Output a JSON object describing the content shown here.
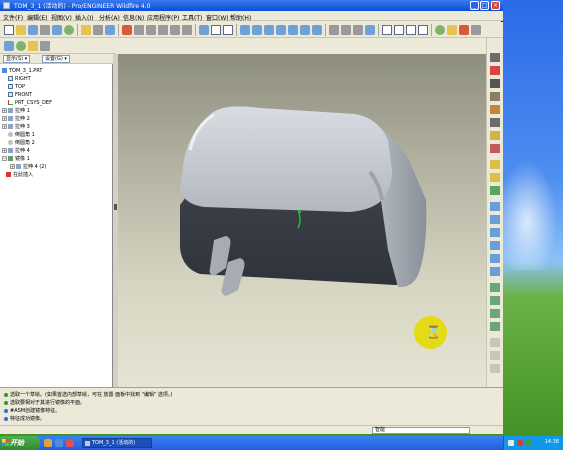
{
  "window": {
    "title": "TOM_3_1 (活动的) - Pro/ENGINEER Wildfire 4.0"
  },
  "menu": [
    "文件(F)",
    "编辑(E)",
    "视图(V)",
    "插入(I)",
    "分析(A)",
    "信息(N)",
    "应用程序(P)",
    "工具(T)",
    "窗口(W)",
    "帮助(H)"
  ],
  "left_panel": {
    "show_button": "显示(S) ▾",
    "settings_button": "设置(G) ▾",
    "tree": [
      {
        "label": "TOM_3_1.PRT",
        "icon": "part-icon",
        "expand": ""
      },
      {
        "label": "RIGHT",
        "icon": "datum-plane-icon",
        "expand": ""
      },
      {
        "label": "TOP",
        "icon": "datum-plane-icon",
        "expand": ""
      },
      {
        "label": "FRONT",
        "icon": "datum-plane-icon",
        "expand": ""
      },
      {
        "label": "PRT_CSYS_DEF",
        "icon": "csys-icon",
        "expand": ""
      },
      {
        "label": "拉伸 1",
        "icon": "extrude-icon",
        "expand": "+"
      },
      {
        "label": "拉伸 2",
        "icon": "extrude-icon",
        "expand": "+"
      },
      {
        "label": "拉伸 3",
        "icon": "extrude-icon",
        "expand": "+"
      },
      {
        "label": "倒圆角 1",
        "icon": "round-icon",
        "expand": ""
      },
      {
        "label": "倒圆角 2",
        "icon": "round-icon",
        "expand": ""
      },
      {
        "label": "拉伸 4",
        "icon": "extrude-icon",
        "expand": "+"
      },
      {
        "label": "镜像 1",
        "icon": "mirror-icon",
        "expand": "−"
      },
      {
        "label": "拉伸 4 (2)",
        "icon": "extrude-icon",
        "expand": "+"
      },
      {
        "label": "在此插入",
        "icon": "insert-here-icon",
        "expand": ""
      }
    ]
  },
  "messages": [
    "选取一个草绘。(如果首选内部草绘，可在 放置 面板中找到 \"编辑\" 选项。)",
    "选取要相对于其进行镜像的平面。",
    "#ASM创建镜像特征。",
    "特征成功镜像。"
  ],
  "status": {
    "filter": "智能"
  },
  "taskbar": {
    "start": "开始",
    "task_button": "TOM_3_1 (活动的)",
    "clock": "14:38"
  },
  "colors": {
    "titlebar": "#0a4ed8",
    "model_face": "#a9aeb6",
    "hourglass_bg": "#e5da16"
  }
}
